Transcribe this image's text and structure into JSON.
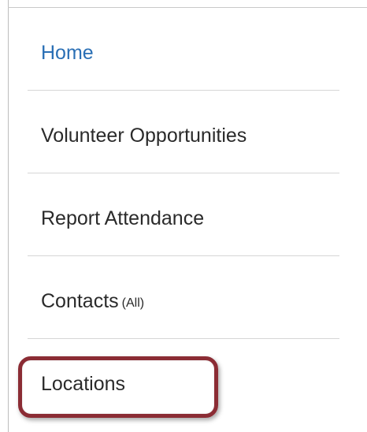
{
  "menu": {
    "items": [
      {
        "label": "Home",
        "active": true
      },
      {
        "label": "Volunteer Opportunities"
      },
      {
        "label": "Report Attendance"
      },
      {
        "label": "Contacts",
        "sub_label": "(All)"
      },
      {
        "label": "Locations",
        "highlighted": true
      }
    ]
  },
  "colors": {
    "link_active": "#2a6fb5",
    "text": "#2a2a2a",
    "highlight_border": "#8b2c34",
    "divider": "#d6d6d6"
  }
}
